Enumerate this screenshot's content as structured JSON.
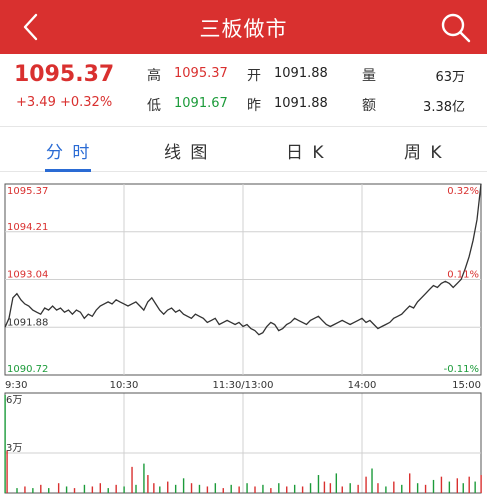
{
  "header": {
    "title": "三板做市",
    "back_icon": "chevron-left-icon",
    "search_icon": "search-icon",
    "bg_color": "#d9302f"
  },
  "quote": {
    "price": "1095.37",
    "change": "+3.49",
    "change_pct": "+0.32%",
    "high_label": "高",
    "high": "1095.37",
    "low_label": "低",
    "low": "1091.67",
    "open_label": "开",
    "open": "1091.88",
    "prev_label": "昨",
    "prev": "1091.88",
    "volume_label": "量",
    "volume": "63万",
    "amount_label": "额",
    "amount": "3.38亿"
  },
  "tabs": [
    {
      "label": "分 时",
      "active": true
    },
    {
      "label": "线 图",
      "active": false
    },
    {
      "label": "日 K",
      "active": false
    },
    {
      "label": "周 K",
      "active": false
    }
  ],
  "chart_data": {
    "type": "line",
    "ylabels_left": [
      "1095.37",
      "1094.21",
      "1093.04",
      "1091.88",
      "1090.72"
    ],
    "ylabels_right": [
      "0.32%",
      "",
      "0.11%",
      "",
      "-0.11%"
    ],
    "xlabels": [
      "9:30",
      "10:30",
      "11:30/13:00",
      "14:00",
      "15:00"
    ],
    "ylim": [
      1090.72,
      1095.37
    ],
    "prev_close": 1091.88,
    "series": [
      {
        "x": [
          0,
          2,
          4,
          6,
          8,
          10,
          12,
          14,
          16,
          18,
          20,
          22,
          24,
          26,
          28,
          30,
          32,
          34,
          36,
          38,
          40,
          42,
          44,
          46,
          48,
          50,
          52,
          54,
          56,
          58,
          60,
          62,
          64,
          66,
          68,
          70,
          72,
          74,
          76,
          78,
          80,
          82,
          84,
          86,
          88,
          90,
          92,
          94,
          96,
          98,
          100,
          102,
          104,
          106,
          108,
          110,
          112,
          114,
          116,
          118,
          120,
          122,
          124,
          126,
          128,
          130,
          132,
          134,
          136,
          138,
          140,
          142,
          144,
          146,
          148,
          150,
          152,
          154,
          156,
          158,
          160,
          162,
          164,
          166,
          168,
          170,
          172,
          174,
          176,
          178,
          180,
          182,
          184,
          186,
          188,
          190,
          192,
          194,
          196,
          198,
          200,
          202,
          204,
          206,
          208,
          210,
          212,
          214,
          216,
          218,
          220,
          222,
          224,
          226,
          228,
          230,
          232,
          234,
          236,
          238,
          240
        ],
        "values": [
          1091.88,
          1092.1,
          1092.6,
          1092.7,
          1092.55,
          1092.45,
          1092.4,
          1092.3,
          1092.25,
          1092.2,
          1092.35,
          1092.3,
          1092.4,
          1092.3,
          1092.35,
          1092.25,
          1092.3,
          1092.2,
          1092.3,
          1092.25,
          1092.1,
          1092.2,
          1092.15,
          1092.3,
          1092.4,
          1092.45,
          1092.5,
          1092.45,
          1092.55,
          1092.5,
          1092.45,
          1092.4,
          1092.45,
          1092.5,
          1092.4,
          1092.3,
          1092.5,
          1092.6,
          1092.45,
          1092.3,
          1092.2,
          1092.3,
          1092.35,
          1092.25,
          1092.3,
          1092.2,
          1092.15,
          1092.1,
          1092.2,
          1092.15,
          1092.1,
          1092.0,
          1092.05,
          1092.1,
          1091.95,
          1092.0,
          1092.05,
          1092.0,
          1091.95,
          1092.0,
          1091.9,
          1091.95,
          1091.85,
          1091.8,
          1091.7,
          1091.75,
          1091.9,
          1092.0,
          1091.95,
          1091.8,
          1091.85,
          1091.95,
          1092.0,
          1092.1,
          1092.05,
          1092.0,
          1091.95,
          1092.05,
          1092.1,
          1092.15,
          1092.05,
          1091.95,
          1091.9,
          1091.95,
          1092.0,
          1092.05,
          1092.0,
          1091.95,
          1092.0,
          1092.05,
          1092.1,
          1092.0,
          1092.05,
          1091.95,
          1091.85,
          1091.9,
          1091.95,
          1092.0,
          1092.1,
          1092.15,
          1092.2,
          1092.3,
          1092.4,
          1092.35,
          1092.5,
          1092.6,
          1092.7,
          1092.8,
          1092.9,
          1092.85,
          1092.95,
          1093.0,
          1092.95,
          1092.85,
          1092.95,
          1093.05,
          1093.3,
          1093.6,
          1094.0,
          1094.5,
          1095.37
        ]
      }
    ],
    "volume": {
      "ymax_label": "6万",
      "ymid_label": "3万",
      "bars": [
        {
          "x": 0,
          "v": 6.0,
          "c": "g"
        },
        {
          "x": 1,
          "v": 2.6,
          "c": "r"
        },
        {
          "x": 6,
          "v": 0.3,
          "c": "g"
        },
        {
          "x": 10,
          "v": 0.4,
          "c": "r"
        },
        {
          "x": 14,
          "v": 0.3,
          "c": "g"
        },
        {
          "x": 18,
          "v": 0.5,
          "c": "r"
        },
        {
          "x": 22,
          "v": 0.3,
          "c": "g"
        },
        {
          "x": 27,
          "v": 0.6,
          "c": "r"
        },
        {
          "x": 31,
          "v": 0.4,
          "c": "g"
        },
        {
          "x": 35,
          "v": 0.3,
          "c": "r"
        },
        {
          "x": 40,
          "v": 0.5,
          "c": "g"
        },
        {
          "x": 44,
          "v": 0.4,
          "c": "r"
        },
        {
          "x": 48,
          "v": 0.6,
          "c": "r"
        },
        {
          "x": 52,
          "v": 0.3,
          "c": "g"
        },
        {
          "x": 56,
          "v": 0.5,
          "c": "r"
        },
        {
          "x": 60,
          "v": 0.4,
          "c": "g"
        },
        {
          "x": 64,
          "v": 1.6,
          "c": "r"
        },
        {
          "x": 66,
          "v": 0.5,
          "c": "g"
        },
        {
          "x": 70,
          "v": 1.8,
          "c": "g"
        },
        {
          "x": 72,
          "v": 1.1,
          "c": "r"
        },
        {
          "x": 75,
          "v": 0.6,
          "c": "r"
        },
        {
          "x": 78,
          "v": 0.4,
          "c": "g"
        },
        {
          "x": 82,
          "v": 0.7,
          "c": "r"
        },
        {
          "x": 86,
          "v": 0.5,
          "c": "g"
        },
        {
          "x": 90,
          "v": 0.9,
          "c": "g"
        },
        {
          "x": 94,
          "v": 0.6,
          "c": "r"
        },
        {
          "x": 98,
          "v": 0.5,
          "c": "g"
        },
        {
          "x": 102,
          "v": 0.4,
          "c": "r"
        },
        {
          "x": 106,
          "v": 0.6,
          "c": "g"
        },
        {
          "x": 110,
          "v": 0.3,
          "c": "r"
        },
        {
          "x": 114,
          "v": 0.5,
          "c": "g"
        },
        {
          "x": 118,
          "v": 0.4,
          "c": "r"
        },
        {
          "x": 122,
          "v": 0.6,
          "c": "g"
        },
        {
          "x": 126,
          "v": 0.4,
          "c": "r"
        },
        {
          "x": 130,
          "v": 0.5,
          "c": "g"
        },
        {
          "x": 134,
          "v": 0.3,
          "c": "r"
        },
        {
          "x": 138,
          "v": 0.6,
          "c": "g"
        },
        {
          "x": 142,
          "v": 0.4,
          "c": "r"
        },
        {
          "x": 146,
          "v": 0.5,
          "c": "g"
        },
        {
          "x": 150,
          "v": 0.4,
          "c": "r"
        },
        {
          "x": 154,
          "v": 0.6,
          "c": "g"
        },
        {
          "x": 158,
          "v": 1.1,
          "c": "g"
        },
        {
          "x": 161,
          "v": 0.7,
          "c": "r"
        },
        {
          "x": 164,
          "v": 0.6,
          "c": "r"
        },
        {
          "x": 167,
          "v": 1.2,
          "c": "g"
        },
        {
          "x": 170,
          "v": 0.4,
          "c": "r"
        },
        {
          "x": 174,
          "v": 0.6,
          "c": "g"
        },
        {
          "x": 178,
          "v": 0.5,
          "c": "r"
        },
        {
          "x": 182,
          "v": 1.0,
          "c": "r"
        },
        {
          "x": 185,
          "v": 1.5,
          "c": "g"
        },
        {
          "x": 188,
          "v": 0.6,
          "c": "r"
        },
        {
          "x": 192,
          "v": 0.4,
          "c": "g"
        },
        {
          "x": 196,
          "v": 0.7,
          "c": "r"
        },
        {
          "x": 200,
          "v": 0.5,
          "c": "g"
        },
        {
          "x": 204,
          "v": 1.2,
          "c": "r"
        },
        {
          "x": 208,
          "v": 0.6,
          "c": "g"
        },
        {
          "x": 212,
          "v": 0.5,
          "c": "r"
        },
        {
          "x": 216,
          "v": 0.8,
          "c": "g"
        },
        {
          "x": 220,
          "v": 1.0,
          "c": "r"
        },
        {
          "x": 224,
          "v": 0.7,
          "c": "g"
        },
        {
          "x": 228,
          "v": 0.9,
          "c": "r"
        },
        {
          "x": 231,
          "v": 0.6,
          "c": "g"
        },
        {
          "x": 234,
          "v": 1.0,
          "c": "r"
        },
        {
          "x": 237,
          "v": 0.7,
          "c": "g"
        },
        {
          "x": 240,
          "v": 1.1,
          "c": "r"
        }
      ]
    },
    "colors": {
      "up": "#d9302f",
      "down": "#1c9b3a",
      "line": "#333333",
      "grid": "#d0d0d0"
    }
  }
}
